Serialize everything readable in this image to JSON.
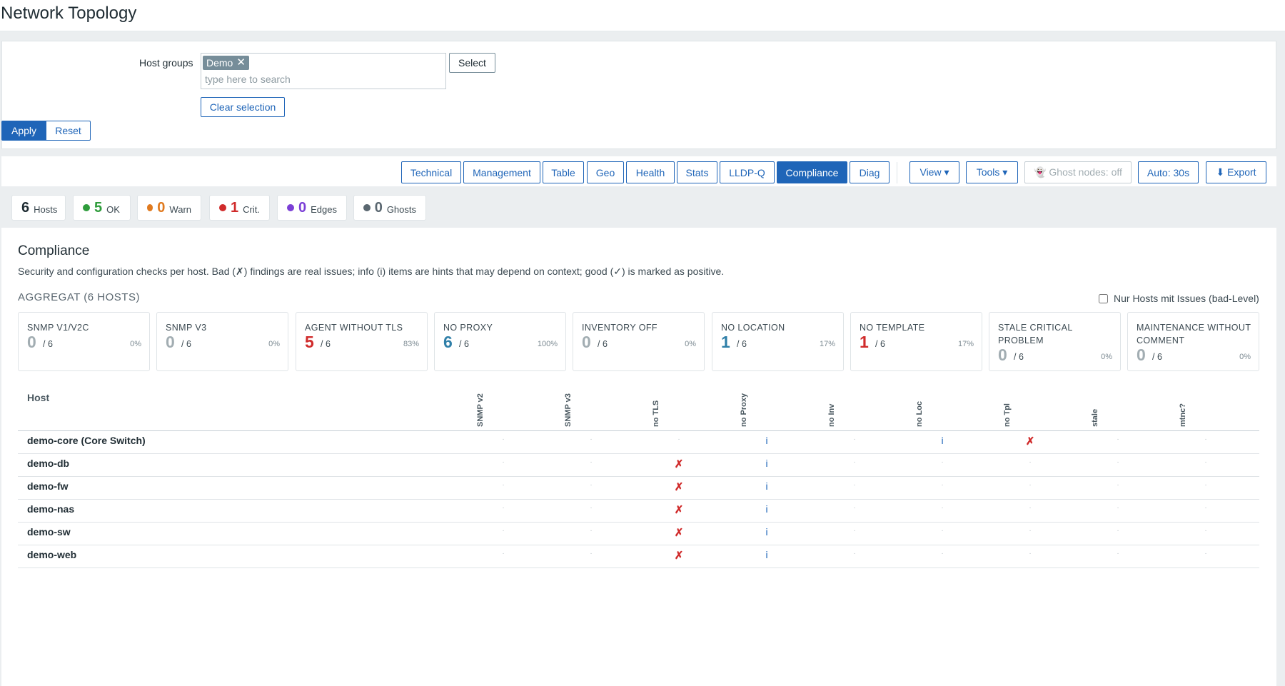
{
  "page": {
    "title": "Network Topology"
  },
  "filter": {
    "host_groups_label": "Host groups",
    "chip_label": "Demo",
    "chip_remove": "✕",
    "search_placeholder": "type here to search",
    "select_label": "Select",
    "clear_label": "Clear selection",
    "apply_label": "Apply",
    "reset_label": "Reset"
  },
  "nav": {
    "tabs": [
      "Technical",
      "Management",
      "Table",
      "Geo",
      "Health",
      "Stats",
      "LLDP-Q",
      "Compliance",
      "Diag"
    ],
    "active_tab": "Compliance",
    "view_label": "View ▾",
    "tools_label": "Tools ▾",
    "ghost_label": "👻 Ghost nodes: off",
    "auto_label": "Auto: 30s",
    "export_label": "⬇ Export"
  },
  "stats": [
    {
      "value": "6",
      "label": "Hosts",
      "color": "#1f2c33"
    },
    {
      "value": "5",
      "label": "OK",
      "color": "#2e9c3b"
    },
    {
      "value": "0",
      "label": "Warn",
      "color": "#e07a1f"
    },
    {
      "value": "1",
      "label": "Crit.",
      "color": "#d02b2b"
    },
    {
      "value": "0",
      "label": "Edges",
      "color": "#7b3fd6"
    },
    {
      "value": "0",
      "label": "Ghosts",
      "color": "#5a6770"
    }
  ],
  "compliance": {
    "title": "Compliance",
    "description": "Security and configuration checks per host. Bad (✗) findings are real issues; info (i) items are hints that may depend on context; good (✓) is marked as positive.",
    "aggregate_title": "AGGREGAT (6 HOSTS)",
    "only_issues_label": "Nur Hosts mit Issues (bad-Level)",
    "cards": [
      {
        "label": "SNMP V1/V2C",
        "value": "0",
        "of": "/ 6",
        "pct": "0%",
        "color": "#a2adb2"
      },
      {
        "label": "SNMP V3",
        "value": "0",
        "of": "/ 6",
        "pct": "0%",
        "color": "#a2adb2"
      },
      {
        "label": "AGENT WITHOUT TLS",
        "value": "5",
        "of": "/ 6",
        "pct": "83%",
        "color": "#d02b2b"
      },
      {
        "label": "NO PROXY",
        "value": "6",
        "of": "/ 6",
        "pct": "100%",
        "color": "#2f7fa8"
      },
      {
        "label": "INVENTORY OFF",
        "value": "0",
        "of": "/ 6",
        "pct": "0%",
        "color": "#a2adb2"
      },
      {
        "label": "NO LOCATION",
        "value": "1",
        "of": "/ 6",
        "pct": "17%",
        "color": "#2f7fa8"
      },
      {
        "label": "NO TEMPLATE",
        "value": "1",
        "of": "/ 6",
        "pct": "17%",
        "color": "#d02b2b"
      },
      {
        "label": "STALE CRITICAL PROBLEM",
        "value": "0",
        "of": "/ 6",
        "pct": "0%",
        "color": "#a2adb2"
      },
      {
        "label": "MAINTENANCE WITHOUT COMMENT",
        "value": "0",
        "of": "/ 6",
        "pct": "0%",
        "color": "#a2adb2"
      }
    ],
    "table": {
      "host_header": "Host",
      "columns": [
        "SNMP v2",
        "SNMP v3",
        "no TLS",
        "no Proxy",
        "no Inv",
        "no Loc",
        "no Tpl",
        "stale",
        "mtnc?"
      ],
      "rows": [
        {
          "host": "demo-core (Core Switch)",
          "cells": [
            "·",
            "·",
            "·",
            "i",
            "·",
            "i",
            "✗",
            "·",
            "·"
          ]
        },
        {
          "host": "demo-db",
          "cells": [
            "·",
            "·",
            "✗",
            "i",
            "·",
            "·",
            "·",
            "·",
            "·"
          ]
        },
        {
          "host": "demo-fw",
          "cells": [
            "·",
            "·",
            "✗",
            "i",
            "·",
            "·",
            "·",
            "·",
            "·"
          ]
        },
        {
          "host": "demo-nas",
          "cells": [
            "·",
            "·",
            "✗",
            "i",
            "·",
            "·",
            "·",
            "·",
            "·"
          ]
        },
        {
          "host": "demo-sw",
          "cells": [
            "·",
            "·",
            "✗",
            "i",
            "·",
            "·",
            "·",
            "·",
            "·"
          ]
        },
        {
          "host": "demo-web",
          "cells": [
            "·",
            "·",
            "✗",
            "i",
            "·",
            "·",
            "·",
            "·",
            "·"
          ]
        }
      ]
    }
  }
}
